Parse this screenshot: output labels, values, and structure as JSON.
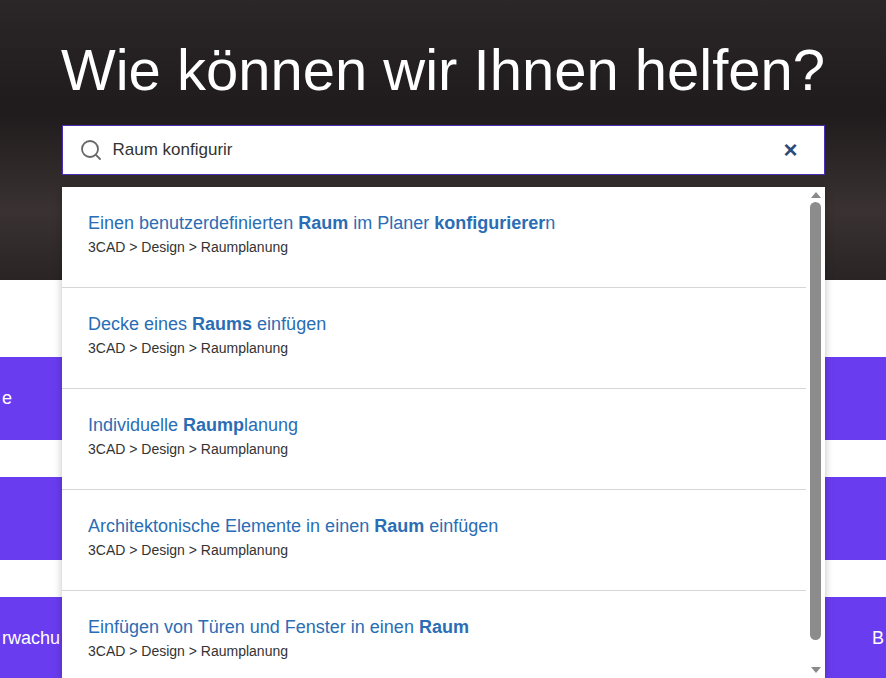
{
  "hero": {
    "title": "Wie können wir Ihnen helfen?"
  },
  "search": {
    "value": "Raum konfigurir",
    "clear": "×"
  },
  "results": [
    {
      "title": [
        {
          "text": "Einen benutzerdefinierten ",
          "bold": false
        },
        {
          "text": "Raum",
          "bold": true
        },
        {
          "text": " im Planer ",
          "bold": false
        },
        {
          "text": "konfigurierer",
          "bold": true
        },
        {
          "text": "n",
          "bold": false
        }
      ],
      "breadcrumb": "3CAD > Design > Raumplanung"
    },
    {
      "title": [
        {
          "text": "Decke eines ",
          "bold": false
        },
        {
          "text": "Raums",
          "bold": true
        },
        {
          "text": " einfügen",
          "bold": false
        }
      ],
      "breadcrumb": "3CAD > Design > Raumplanung"
    },
    {
      "title": [
        {
          "text": "Individuelle ",
          "bold": false
        },
        {
          "text": "Raump",
          "bold": true
        },
        {
          "text": "lanung",
          "bold": false
        }
      ],
      "breadcrumb": "3CAD > Design > Raumplanung"
    },
    {
      "title": [
        {
          "text": "Architektonische Elemente in einen ",
          "bold": false
        },
        {
          "text": "Raum",
          "bold": true
        },
        {
          "text": " einfügen",
          "bold": false
        }
      ],
      "breadcrumb": "3CAD > Design > Raumplanung"
    },
    {
      "title": [
        {
          "text": "Einfügen von Türen und Fenster in einen ",
          "bold": false
        },
        {
          "text": "Raum",
          "bold": true
        }
      ],
      "breadcrumb": "3CAD > Design > Raumplanung"
    }
  ],
  "scrollbar": {
    "level": 0.95
  },
  "tile_rows": [
    {
      "cells": [
        "e",
        "",
        ""
      ]
    },
    {
      "cells": [
        "",
        "",
        ""
      ]
    },
    {
      "cells": [
        "rwachu",
        "",
        "B"
      ]
    }
  ]
}
